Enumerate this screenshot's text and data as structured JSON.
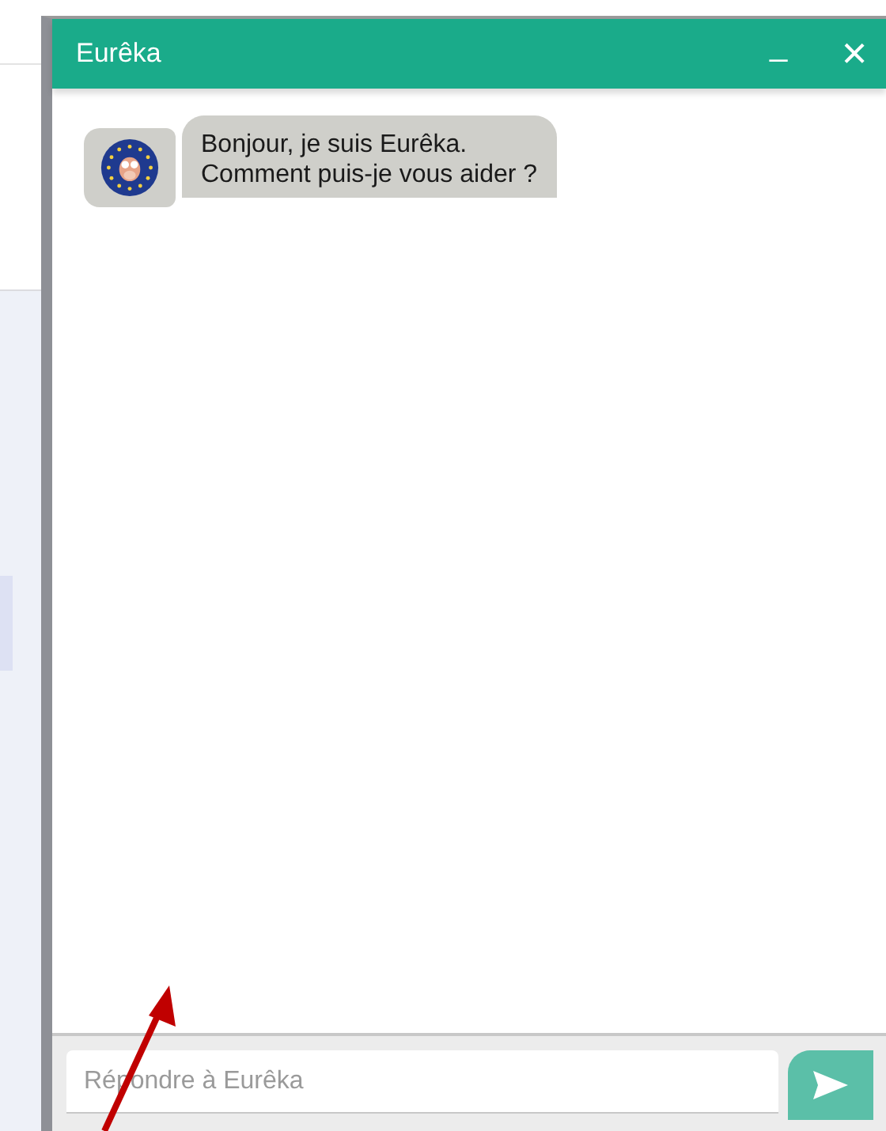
{
  "window": {
    "title": "Eurêka",
    "minimize": "_",
    "close": "×"
  },
  "messages": [
    {
      "lines": [
        "Bonjour, je suis Eurêka.",
        "Comment puis-je vous aider ?"
      ]
    }
  ],
  "reply": {
    "placeholder": "Répondre à Eurêka"
  }
}
